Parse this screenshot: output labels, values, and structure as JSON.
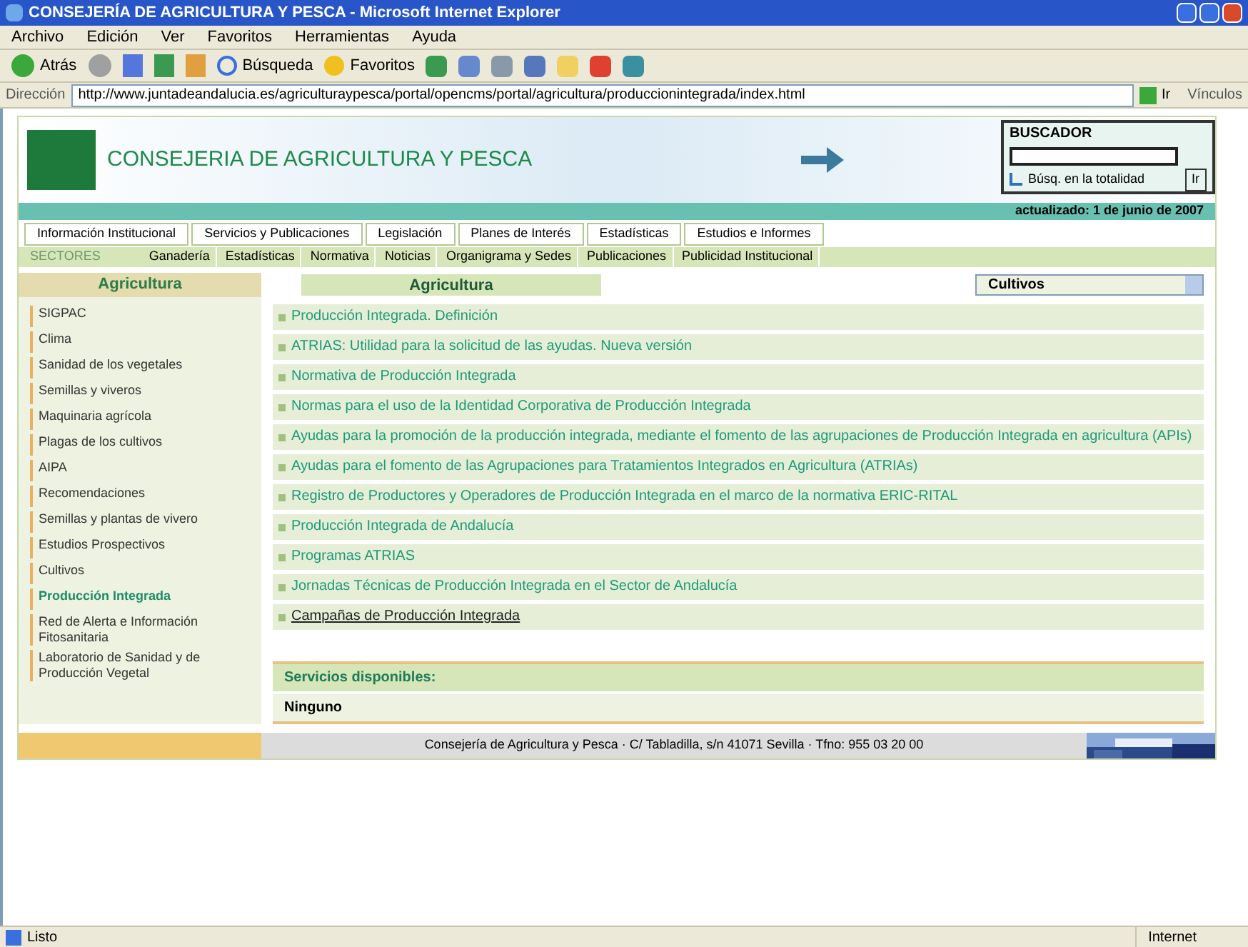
{
  "window": {
    "title": "CONSEJERÍA DE AGRICULTURA Y PESCA - Microsoft Internet Explorer"
  },
  "menu": [
    "Archivo",
    "Edición",
    "Ver",
    "Favoritos",
    "Herramientas",
    "Ayuda"
  ],
  "toolbar": {
    "back": "Atrás",
    "search": "Búsqueda",
    "favorites": "Favoritos"
  },
  "address_bar": {
    "label": "Dirección",
    "value": "http://www.juntadeandalucia.es/agriculturaypesca/portal/opencms/portal/agricultura/produccionintegrada/index.html",
    "go": "Ir",
    "links": "Vínculos"
  },
  "header": {
    "title": "CONSEJERIA DE AGRICULTURA Y PESCA"
  },
  "search_box": {
    "title": "BUSCADOR",
    "advanced": {
      "label": "Búsq. en la totalidad",
      "checked": false
    },
    "go": "Ir",
    "updated": "actualizado: 1 de junio de 2007"
  },
  "nav_main": [
    {
      "label": "Información Institucional"
    },
    {
      "label": "Servicios y Publicaciones"
    },
    {
      "label": "Legislación"
    },
    {
      "label": "Planes de Interés"
    },
    {
      "label": "Estadísticas"
    },
    {
      "label": "Estudios e Informes"
    }
  ],
  "nav_sub": {
    "label": "SECTORES",
    "items": [
      {
        "label": "Ganadería"
      },
      {
        "label": "Estadísticas"
      },
      {
        "label": "Normativa"
      },
      {
        "label": "Noticias"
      },
      {
        "label": "Organigrama y Sedes"
      },
      {
        "label": "Publicaciones"
      },
      {
        "label": "Publicidad Institucional"
      }
    ]
  },
  "sidebar": {
    "title": "Agricultura",
    "items": [
      {
        "label": "SIGPAC",
        "selected": false
      },
      {
        "label": "Clima",
        "selected": false
      },
      {
        "label": "Sanidad de los vegetales",
        "selected": false
      },
      {
        "label": "Semillas y viveros",
        "selected": false
      },
      {
        "label": "Maquinaria agrícola",
        "selected": false
      },
      {
        "label": "Plagas de los cultivos",
        "selected": false
      },
      {
        "label": "AIPA",
        "selected": false
      },
      {
        "label": "Recomendaciones",
        "selected": false
      },
      {
        "label": "Semillas y plantas de vivero",
        "selected": false
      },
      {
        "label": "Estudios Prospectivos",
        "selected": false
      },
      {
        "label": "Cultivos",
        "selected": false
      },
      {
        "label": "Producción Integrada",
        "selected": true
      },
      {
        "label": "Red de Alerta e Información Fitosanitaria",
        "selected": false
      },
      {
        "label": "Laboratorio de Sanidad y de Producción Vegetal",
        "selected": false
      }
    ]
  },
  "main": {
    "title": "Agricultura",
    "filter": "Cultivos",
    "links": [
      {
        "label": "Producción Integrada. Definición",
        "underlined": false
      },
      {
        "label": "ATRIAS: Utilidad para la solicitud de las ayudas. Nueva versión",
        "underlined": false
      },
      {
        "label": "Normativa de Producción Integrada",
        "underlined": false
      },
      {
        "label": "Normas para el uso de la Identidad Corporativa de Producción Integrada",
        "underlined": false
      },
      {
        "label": "Ayudas para la promoción de la producción integrada, mediante el fomento de las agrupaciones de Producción Integrada en agricultura (APIs)",
        "underlined": false
      },
      {
        "label": "Ayudas para el fomento de las Agrupaciones para Tratamientos Integrados en Agricultura (ATRIAs)",
        "underlined": false
      },
      {
        "label": "Registro de Productores y Operadores de Producción Integrada en el marco de la normativa ERIC-RITAL",
        "underlined": false
      },
      {
        "label": "Producción Integrada de Andalucía",
        "underlined": false
      },
      {
        "label": "Programas ATRIAS",
        "underlined": false
      },
      {
        "label": "Jornadas Técnicas de Producción Integrada en el Sector de Andalucía",
        "underlined": false
      },
      {
        "label": "Campañas de Producción Integrada",
        "underlined": true
      }
    ],
    "services_title": "Servicios disponibles:",
    "services_value": "Ninguno"
  },
  "footer": {
    "text": "Consejería de Agricultura y Pesca · C/ Tabladilla, s/n 41071 Sevilla · Tfno: 955 03 20 00"
  },
  "status_bar": {
    "text": "Listo",
    "zone": "Internet"
  }
}
